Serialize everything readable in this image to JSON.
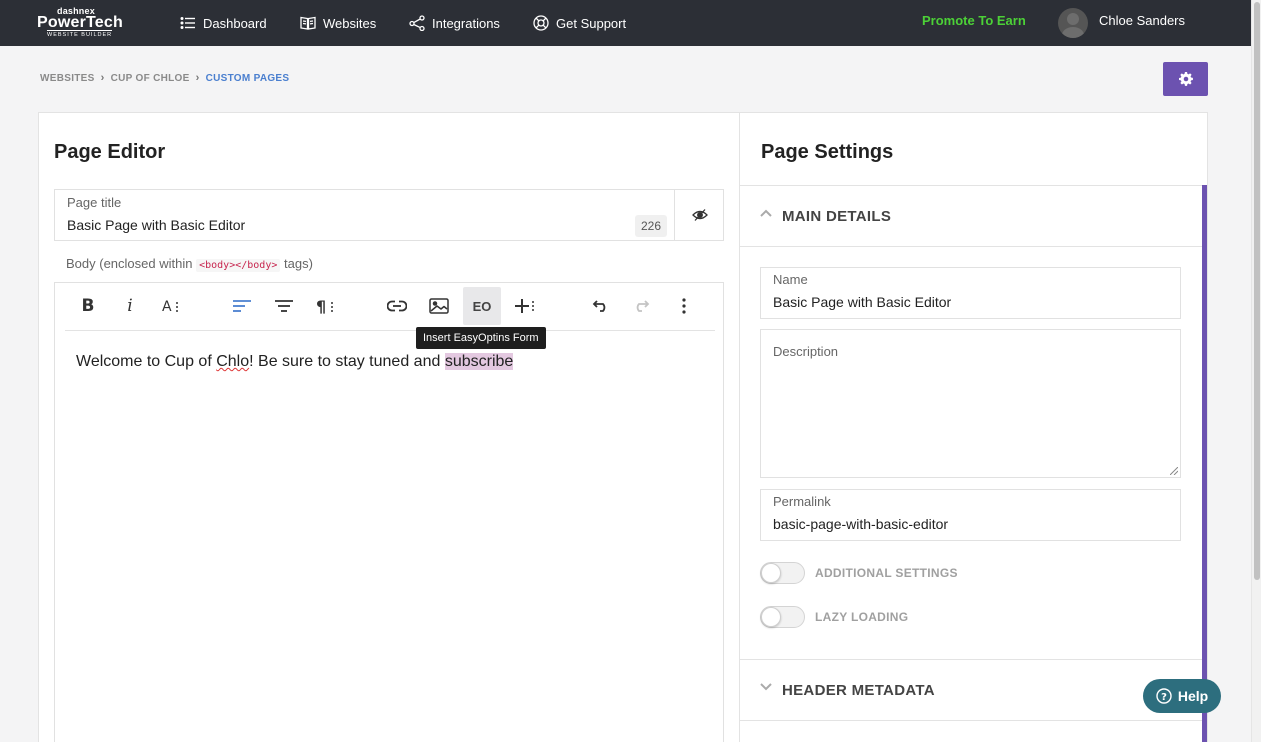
{
  "brand": {
    "top": "dashnex",
    "name": "PowerTech",
    "sub": "WEBSITE BUILDER"
  },
  "nav": {
    "items": [
      {
        "label": "Dashboard",
        "icon": "list-icon"
      },
      {
        "label": "Websites",
        "icon": "book-icon"
      },
      {
        "label": "Integrations",
        "icon": "share-icon"
      },
      {
        "label": "Get Support",
        "icon": "lifebuoy-icon"
      }
    ],
    "promote": "Promote To Earn",
    "user": "Chloe Sanders"
  },
  "breadcrumb": [
    "WEBSITES",
    "CUP OF CHLOE",
    "CUSTOM PAGES"
  ],
  "editor": {
    "title": "Page Editor",
    "page_title_label": "Page title",
    "page_title_value": "Basic Page with Basic Editor",
    "char_count": "226",
    "body_label_prefix": "Body (enclosed within",
    "body_label_code": "<body></body>",
    "body_label_suffix": "tags)",
    "tooltip": "Insert EasyOptins Form",
    "eo_label": "EO",
    "content_pre": "Welcome to Cup of ",
    "content_misspelled": "Chlo",
    "content_mid": "! Be sure to stay tuned and ",
    "content_highlight": "subscribe"
  },
  "settings": {
    "title": "Page Settings",
    "main_details": "MAIN DETAILS",
    "name_label": "Name",
    "name_value": "Basic Page with Basic Editor",
    "description_label": "Description",
    "permalink_label": "Permalink",
    "permalink_value": "basic-page-with-basic-editor",
    "additional_settings": "ADDITIONAL SETTINGS",
    "lazy_loading": "LAZY LOADING",
    "header_metadata": "HEADER METADATA"
  },
  "help": "Help",
  "colors": {
    "nav_bg": "#2c2f36",
    "accent": "#6c52b0",
    "promote": "#4cd137",
    "help_bg": "#2d6e7e",
    "crumb_active": "#4a7fcf"
  }
}
